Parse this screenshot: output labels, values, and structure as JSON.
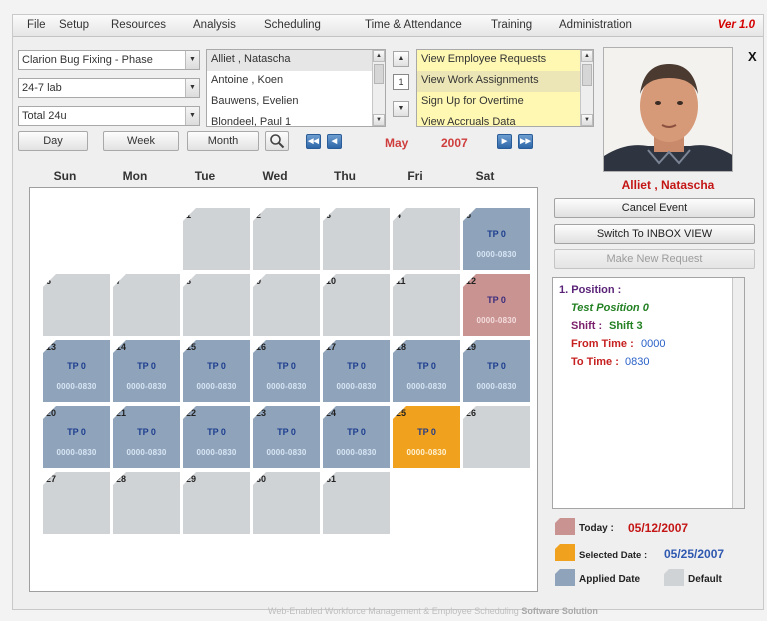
{
  "menu": [
    "File",
    "Setup",
    "Resources",
    "Analysis",
    "Scheduling",
    "Time & Attendance",
    "Training",
    "Administration"
  ],
  "version": "Ver 1.0",
  "filters": {
    "project": "Clarion Bug Fixing - Phase ",
    "location": "24-7 lab",
    "shift_group": "Total 24u"
  },
  "employees": [
    "Alliet , Natascha",
    "Antoine , Koen",
    "Bauwens, Evelien",
    "Blondeel, Paul 1"
  ],
  "spinner_value": "1",
  "actions": [
    "View Employee Requests",
    "View Work Assignments",
    "Sign Up for Overtime",
    "View Accruals Data"
  ],
  "view_buttons": {
    "day": "Day",
    "week": "Week",
    "month": "Month"
  },
  "nav": {
    "prev_year": "◀◀",
    "prev_month": "◀",
    "next_month": "▶",
    "next_year": "▶▶"
  },
  "period": {
    "month": "May",
    "year": "2007"
  },
  "weekdays": [
    "Sun",
    "Mon",
    "Tue",
    "Wed",
    "Thu",
    "Fri",
    "Sat"
  ],
  "calendar": {
    "first_weekday": 2,
    "days_in_month": 31,
    "event_code": "TP 0",
    "event_time": "0000-0830",
    "applied_days": [
      5,
      13,
      14,
      15,
      16,
      17,
      18,
      19,
      20,
      21,
      22,
      23,
      24
    ],
    "today_day": 12,
    "selected_day": 25,
    "colors": {
      "default": "#d0d3d6",
      "applied": "#8fa3ba",
      "today": "#c99391",
      "selected": "#f0a11d"
    }
  },
  "employee_name": "Alliet , Natascha",
  "close_label": "X",
  "side_buttons": {
    "cancel": "Cancel Event",
    "switch": "Switch To INBOX VIEW",
    "request": "Make New Request"
  },
  "detail": {
    "position_label": "1. Position :",
    "position_value": "Test Position 0",
    "shift_label": "Shift :",
    "shift_value": "Shift 3",
    "from_label": "From Time :",
    "from_value": "0000",
    "to_label": "To Time :",
    "to_value": "0830"
  },
  "legend": {
    "today_label": "Today :",
    "today_date": "05/12/2007",
    "selected_label": "Selected Date :",
    "selected_date": "05/25/2007",
    "applied_label": "Applied Date",
    "default_label": "Default"
  },
  "footer": {
    "text": "Web-Enabled Workforce Management & Employee Scheduling",
    "brand": "Software Solution"
  }
}
